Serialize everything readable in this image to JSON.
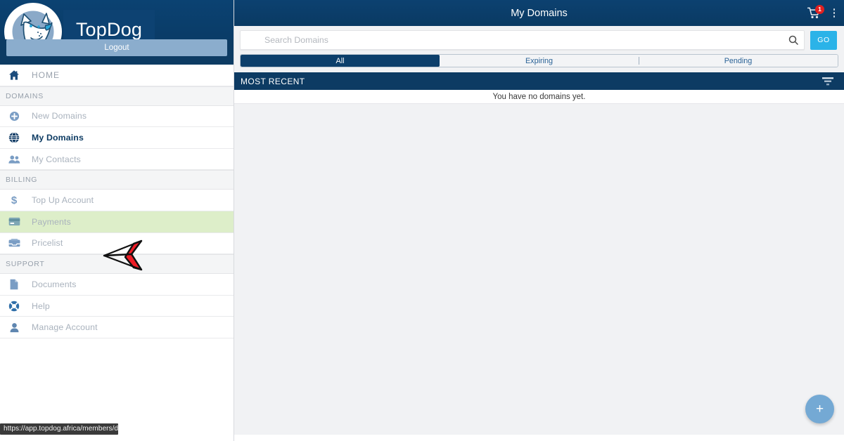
{
  "brand": {
    "name": "TopDog",
    "logo_icon": "dog-head-logo",
    "logout_label": "Logout"
  },
  "sidebar": {
    "groups": [
      {
        "header": null,
        "items": [
          {
            "label": "HOME",
            "icon": "home-icon",
            "name": "home",
            "state": "default"
          }
        ]
      },
      {
        "header": "DOMAINS",
        "items": [
          {
            "label": "New Domains",
            "icon": "plus-circle-icon",
            "name": "new-domains",
            "state": "default"
          },
          {
            "label": "My Domains",
            "icon": "globe-icon",
            "name": "my-domains",
            "state": "active"
          },
          {
            "label": "My Contacts",
            "icon": "contacts-icon",
            "name": "my-contacts",
            "state": "default"
          }
        ]
      },
      {
        "header": "BILLING",
        "items": [
          {
            "label": "Top Up Account",
            "icon": "dollar-icon",
            "name": "top-up-account",
            "state": "default"
          },
          {
            "label": "Payments",
            "icon": "credit-card-icon",
            "name": "payments",
            "state": "highlight"
          },
          {
            "label": "Pricelist",
            "icon": "inbox-icon",
            "name": "pricelist",
            "state": "default"
          }
        ]
      },
      {
        "header": "SUPPORT",
        "items": [
          {
            "label": "Documents",
            "icon": "document-icon",
            "name": "documents",
            "state": "default"
          },
          {
            "label": "Help",
            "icon": "lifebuoy-icon",
            "name": "help",
            "state": "default"
          },
          {
            "label": "Manage Account",
            "icon": "person-icon",
            "name": "manage-account",
            "state": "default"
          }
        ]
      }
    ],
    "status_url": "https://app.topdog.africa/members/domains"
  },
  "header": {
    "title": "My Domains",
    "cart_icon": "shopping-cart-icon",
    "cart_badge": "1",
    "menu_icon": "vertical-dots-icon"
  },
  "search": {
    "value": "",
    "placeholder": "Search Domains",
    "search_icon": "search-icon",
    "go_label": "GO"
  },
  "tabs": [
    {
      "label": "All",
      "active": true
    },
    {
      "label": "Expiring",
      "active": false
    },
    {
      "label": "Pending",
      "active": false
    }
  ],
  "list": {
    "section_label": "MOST RECENT",
    "filter_icon": "filter-icon",
    "empty_message": "You have no domains yet."
  },
  "fab": {
    "label": "+",
    "icon": "plus-icon"
  },
  "annotation": {
    "type": "red-arrow-pointer",
    "points_to": "Payments"
  },
  "colors": {
    "brand_navy": "#0d3b63",
    "accent_cyan": "#2bb3e8",
    "highlight_green": "#ddeec9",
    "badge_red": "#e02020",
    "fab_blue": "#74a9d4",
    "annotation_red": "#ee1c25"
  }
}
